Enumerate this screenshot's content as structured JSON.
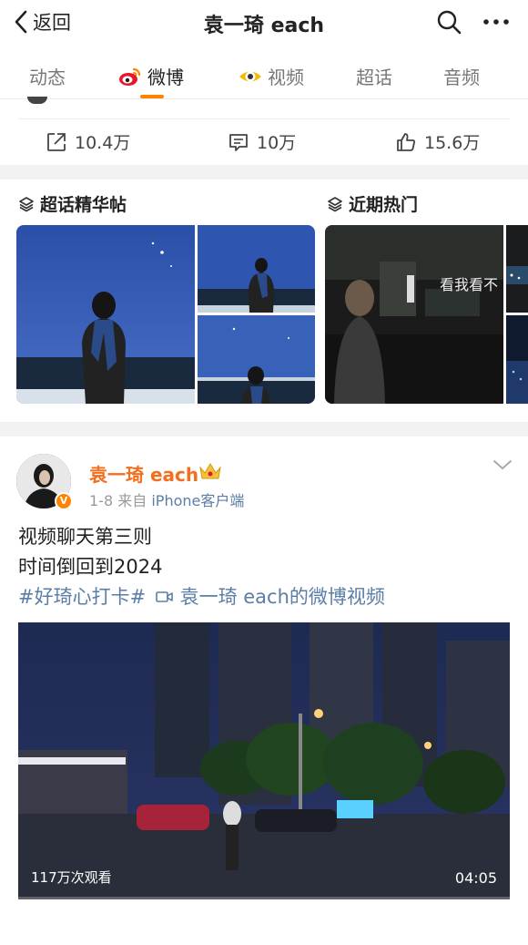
{
  "nav": {
    "back_label": "返回",
    "title": "袁一琦 each"
  },
  "tabs": [
    {
      "label": "动态"
    },
    {
      "label": "微博"
    },
    {
      "label": "视频"
    },
    {
      "label": "超话"
    },
    {
      "label": "音频"
    }
  ],
  "actions": {
    "share": "10.4万",
    "comment": "10万",
    "like": "15.6万"
  },
  "sections": {
    "left": "超话精华帖",
    "right": "近期热门"
  },
  "hot_overlay_text": "看我看不",
  "post": {
    "username": "袁一琦 each",
    "verified_badge": "V",
    "date": "1-8",
    "source_prefix": "来自",
    "source": "iPhone客户端",
    "line1": "视频聊天第三则",
    "line2": "时间倒回到2024",
    "hashtag": "#好琦心打卡#",
    "video_link": "袁一琦 each的微博视频",
    "video_views": "117万次观看",
    "video_duration": "04:05"
  },
  "colors": {
    "accent": "#ff8200",
    "link": "#5b7ea6",
    "username": "#f36e1d"
  }
}
